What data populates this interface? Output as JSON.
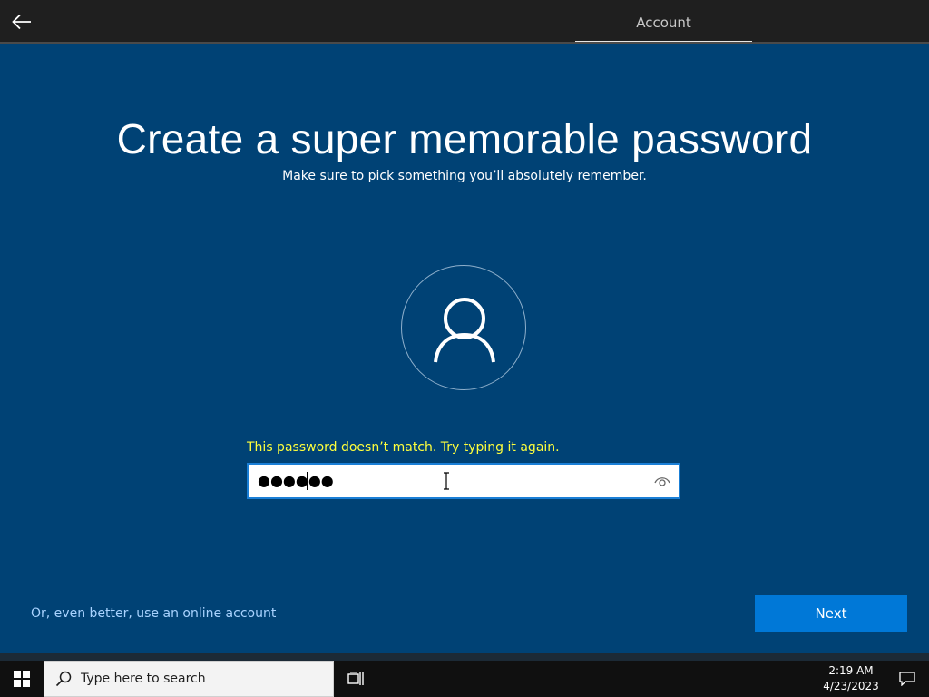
{
  "header": {
    "tab_label": "Account"
  },
  "main": {
    "title": "Create a super memorable password",
    "subtitle": "Make sure to pick something you’ll absolutely remember.",
    "error_message": "This password doesn’t match. Try typing it again.",
    "password_masked": "●●●●●●"
  },
  "footer": {
    "online_account_link": "Or, even better, use an online account",
    "next_label": "Next"
  },
  "taskbar": {
    "search_placeholder": "Type here to search",
    "time": "2:19 AM",
    "date": "4/23/2023"
  },
  "colors": {
    "background": "#004275",
    "accent": "#0078d7",
    "error": "#ffff3c",
    "link": "#a9d3ff"
  },
  "icons": [
    "back-arrow-icon",
    "user-icon",
    "reveal-password-eye-icon",
    "windows-logo-icon",
    "search-icon",
    "task-view-icon",
    "notification-icon"
  ]
}
